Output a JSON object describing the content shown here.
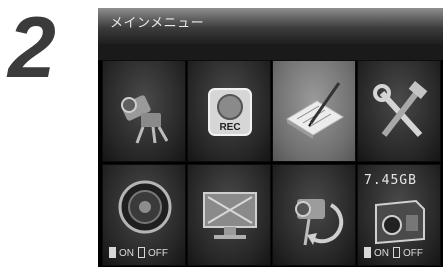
{
  "step": "2",
  "screen": {
    "title": "メインメニュー",
    "tiles": [
      {
        "name": "camera-settings-icon"
      },
      {
        "name": "rec-icon",
        "badge": "REC"
      },
      {
        "name": "notepad-pen-icon",
        "selected": true
      },
      {
        "name": "tools-icon"
      },
      {
        "name": "speaker-icon",
        "on_label": "ON",
        "off_label": "OFF"
      },
      {
        "name": "monitor-icon"
      },
      {
        "name": "camera-rotate-icon"
      },
      {
        "name": "sd-card-icon",
        "storage": "7.45GB",
        "on_label": "ON",
        "off_label": "OFF"
      }
    ]
  }
}
